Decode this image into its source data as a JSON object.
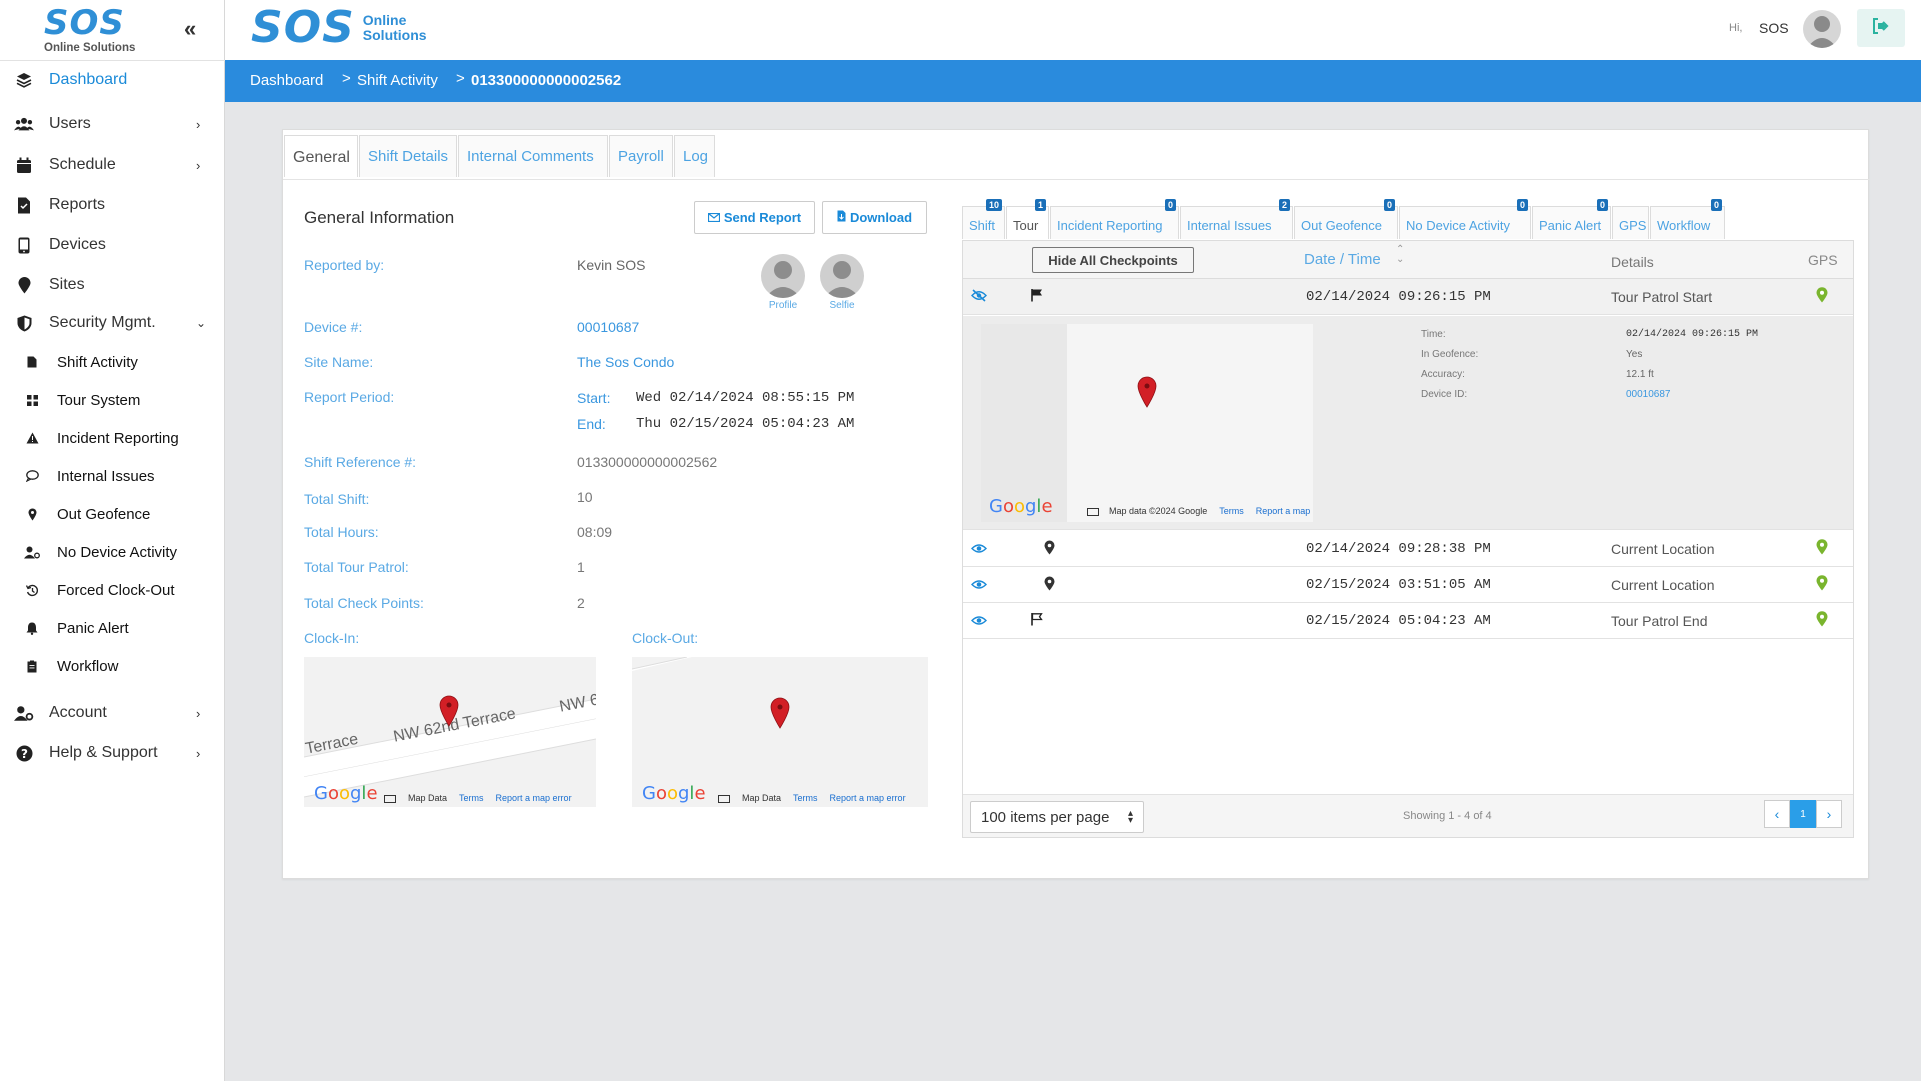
{
  "sidebar": {
    "logo_mark": "SOS",
    "logo_sub": "Online Solutions",
    "collapse_icon": "«",
    "items": [
      {
        "label": "Dashboard"
      },
      {
        "label": "Users"
      },
      {
        "label": "Schedule"
      },
      {
        "label": "Reports"
      },
      {
        "label": "Devices"
      },
      {
        "label": "Sites"
      },
      {
        "label": "Security Mgmt."
      },
      {
        "label": "Account"
      },
      {
        "label": "Help & Support"
      }
    ],
    "security_sub": [
      {
        "label": "Shift Activity"
      },
      {
        "label": "Tour System"
      },
      {
        "label": "Incident Reporting"
      },
      {
        "label": "Internal Issues"
      },
      {
        "label": "Out Geofence"
      },
      {
        "label": "No Device Activity"
      },
      {
        "label": "Forced Clock-Out"
      },
      {
        "label": "Panic Alert"
      },
      {
        "label": "Workflow"
      }
    ]
  },
  "header": {
    "logo_mark": "SOS",
    "logo_line1": "Online",
    "logo_line2": "Solutions",
    "greeting": "Hi,",
    "user_name": "SOS"
  },
  "breadcrumb": {
    "items": [
      "Dashboard",
      "Shift Activity",
      "013300000000002562"
    ],
    "separator": ">"
  },
  "tabs": [
    {
      "label": "General"
    },
    {
      "label": "Shift Details"
    },
    {
      "label": "Internal Comments"
    },
    {
      "label": "Payroll"
    },
    {
      "label": "Log"
    }
  ],
  "general": {
    "title": "General Information",
    "send_report": "Send Report",
    "download": "Download",
    "reported_by_label": "Reported by:",
    "reported_by_value": "Kevin SOS",
    "profile_caption": "Profile",
    "selfie_caption": "Selfie",
    "device_label": "Device #:",
    "device_value": "00010687",
    "site_label": "Site Name:",
    "site_value": "The Sos Condo",
    "period_label": "Report Period:",
    "start_label": "Start:",
    "start_value": "Wed 02/14/2024 08:55:15 PM",
    "end_label": "End:",
    "end_value": "Thu 02/15/2024 05:04:23 AM",
    "shift_ref_label": "Shift Reference #:",
    "shift_ref_value": "013300000000002562",
    "total_shift_label": "Total Shift:",
    "total_shift_value": "10",
    "total_hours_label": "Total Hours:",
    "total_hours_value": "08:09",
    "total_tour_label": "Total Tour Patrol:",
    "total_tour_value": "1",
    "total_check_label": "Total Check Points:",
    "total_check_value": "2",
    "clock_in_label": "Clock-In:",
    "clock_out_label": "Clock-Out:",
    "map_street_1": "NW 62nd Terrace",
    "map_street_2": "Terrace",
    "map_street_3": "NW 6",
    "google": "Google",
    "map_data": "Map Data",
    "terms": "Terms",
    "report_error": "Report a map error"
  },
  "right_tabs": [
    {
      "label": "Shift",
      "badge": "10"
    },
    {
      "label": "Tour",
      "badge": "1"
    },
    {
      "label": "Incident Reporting",
      "badge": "0"
    },
    {
      "label": "Internal Issues",
      "badge": "2"
    },
    {
      "label": "Out Geofence",
      "badge": "0"
    },
    {
      "label": "No Device Activity",
      "badge": "0"
    },
    {
      "label": "Panic Alert",
      "badge": "0"
    },
    {
      "label": "GPS",
      "badge": ""
    },
    {
      "label": "Workflow",
      "badge": "0"
    }
  ],
  "grid": {
    "hide_button": "Hide All Checkpoints",
    "col_datetime": "Date / Time",
    "col_details": "Details",
    "col_gps": "GPS",
    "rows": [
      {
        "datetime": "02/14/2024 09:26:15 PM",
        "details": "Tour Patrol Start",
        "type": "flag-filled"
      },
      {
        "datetime": "02/14/2024 09:28:38 PM",
        "details": "Current Location",
        "type": "pin"
      },
      {
        "datetime": "02/15/2024 03:51:05 AM",
        "details": "Current Location",
        "type": "pin"
      },
      {
        "datetime": "02/15/2024 05:04:23 AM",
        "details": "Tour Patrol End",
        "type": "flag-outline"
      }
    ],
    "expanded": {
      "time_label": "Time:",
      "time_value": "02/14/2024 09:26:15 PM",
      "geofence_label": "In Geofence:",
      "geofence_value": "Yes",
      "accuracy_label": "Accuracy:",
      "accuracy_value": "12.1 ft",
      "device_label": "Device ID:",
      "device_value": "00010687",
      "map_footer": "Map data ©2024 Google",
      "terms": "Terms",
      "report_error": "Report a map error",
      "google": "Google"
    },
    "per_page": "100 items per page",
    "showing": "Showing 1 - 4 of 4",
    "page": "1"
  },
  "colors": {
    "accent": "#2a8bdd",
    "link": "#5aa9e4",
    "gps_green": "#7ab52e",
    "pin_red": "#d21f26"
  }
}
